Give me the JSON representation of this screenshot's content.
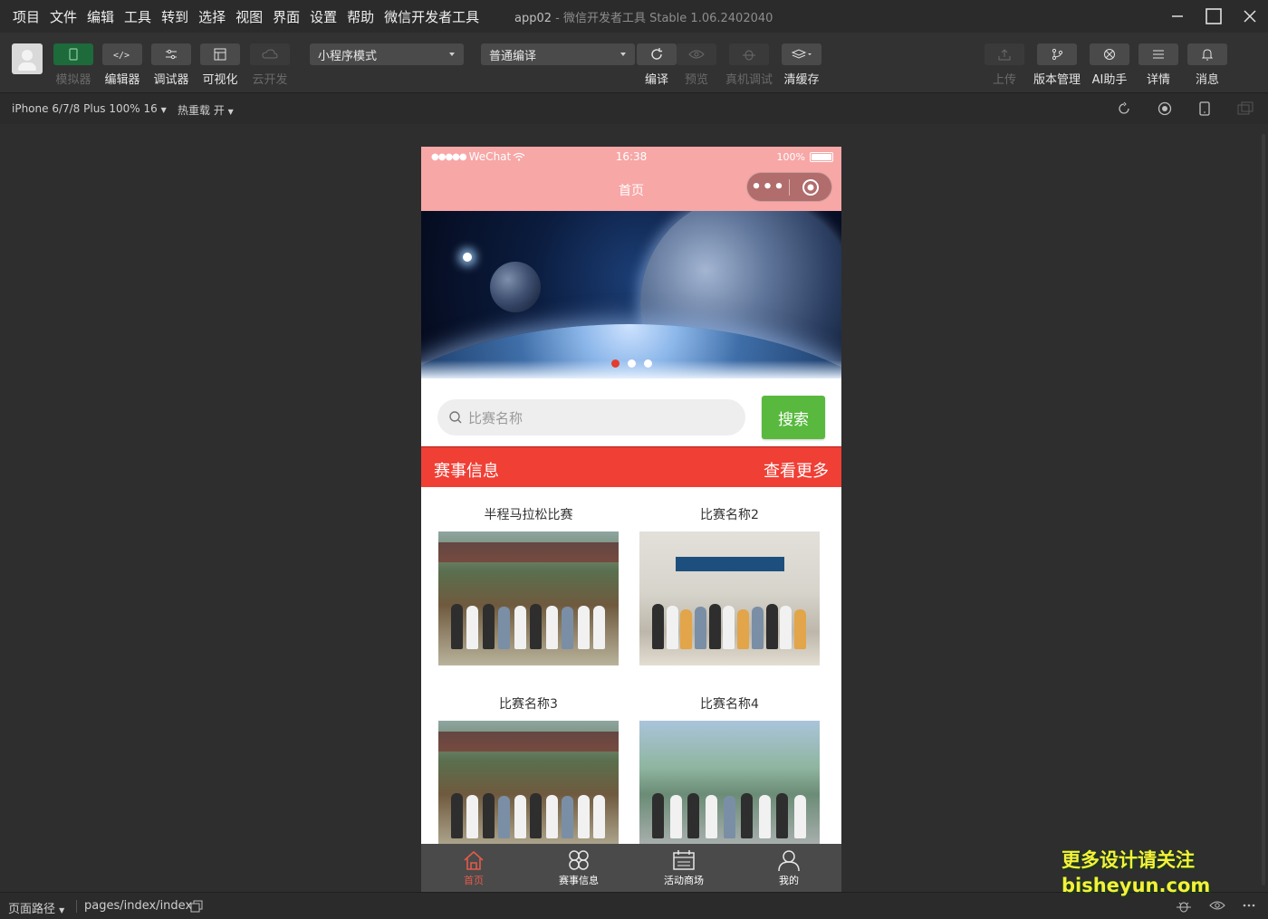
{
  "menubar": {
    "items": [
      "项目",
      "文件",
      "编辑",
      "工具",
      "转到",
      "选择",
      "视图",
      "界面",
      "设置",
      "帮助",
      "微信开发者工具"
    ],
    "app_name": "app02",
    "title_sep": " - ",
    "title_rest": "微信开发者工具 Stable 1.06.2402040"
  },
  "toolbar": {
    "left_buttons": [
      "模拟器",
      "编辑器",
      "调试器",
      "可视化",
      "云开发"
    ],
    "mode_select": "小程序模式",
    "compile_select": "普通编译",
    "mid_buttons": [
      "编译",
      "预览",
      "真机调试",
      "清缓存"
    ],
    "right_buttons": [
      "上传",
      "版本管理",
      "AI助手",
      "详情",
      "消息"
    ]
  },
  "subbar": {
    "device": "iPhone 6/7/8 Plus 100% 16",
    "hot_reload": "热重载 开"
  },
  "phone": {
    "status": {
      "carrier": "WeChat",
      "time": "16:38",
      "battery": "100%"
    },
    "page_title": "首页",
    "banner_active_dot": 0,
    "search": {
      "placeholder": "比赛名称",
      "button": "搜索"
    },
    "section": {
      "title": "赛事信息",
      "more": "查看更多"
    },
    "cards": [
      {
        "title": "半程马拉松比赛"
      },
      {
        "title": "比赛名称2"
      },
      {
        "title": "比赛名称3"
      },
      {
        "title": "比赛名称4"
      }
    ],
    "tabs": [
      {
        "label": "首页",
        "icon": "home-icon",
        "active": true
      },
      {
        "label": "赛事信息",
        "icon": "grid-icon",
        "active": false
      },
      {
        "label": "活动商场",
        "icon": "calendar-icon",
        "active": false
      },
      {
        "label": "我的",
        "icon": "user-icon",
        "active": false
      }
    ]
  },
  "footer": {
    "path_label": "页面路径",
    "path": "pages/index/index"
  },
  "watermark": {
    "line1": "更多设计请关注",
    "line2": "bisheyun.com"
  },
  "colors": {
    "nav_bg": "#f7a7a6",
    "section_red": "#f03f35",
    "search_green": "#58b93e",
    "tab_active": "#e35b4a"
  }
}
